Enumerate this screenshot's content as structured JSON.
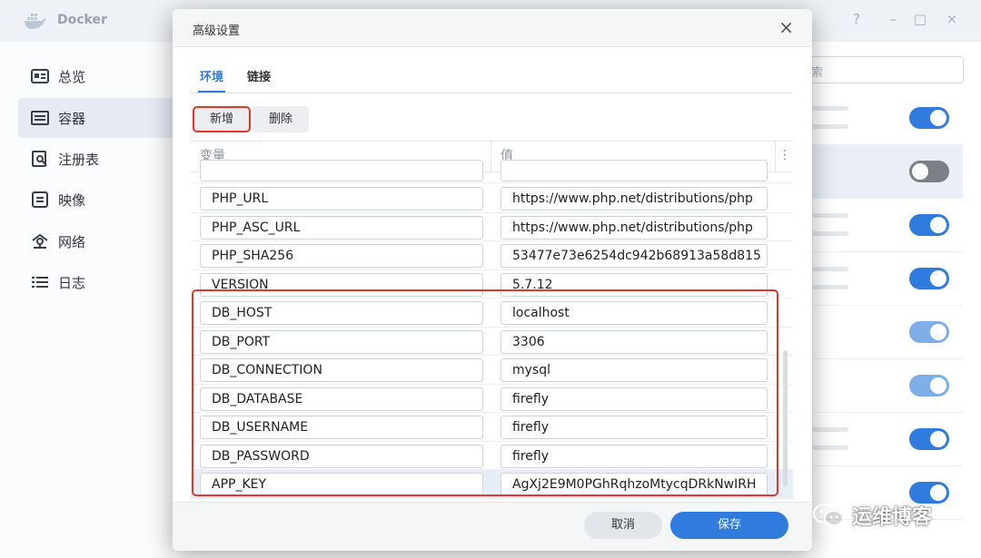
{
  "app": {
    "title": "Docker",
    "controls": [
      "?",
      "–",
      "□",
      "×"
    ]
  },
  "sidebar": {
    "items": [
      {
        "label": "总览",
        "icon": "overview-icon"
      },
      {
        "label": "容器",
        "icon": "container-list-icon",
        "active": true
      },
      {
        "label": "注册表",
        "icon": "registry-search-icon"
      },
      {
        "label": "映像",
        "icon": "image-icon"
      },
      {
        "label": "网络",
        "icon": "network-icon"
      },
      {
        "label": "日志",
        "icon": "log-list-icon"
      }
    ]
  },
  "search": {
    "placeholder": "索"
  },
  "container_list": {
    "toggles": [
      {
        "state": "on"
      },
      {
        "state": "off"
      },
      {
        "state": "on"
      },
      {
        "state": "on"
      },
      {
        "state": "on-dim"
      },
      {
        "state": "on-dim"
      },
      {
        "state": "on"
      },
      {
        "state": "on"
      }
    ]
  },
  "modal": {
    "title": "高级设置",
    "close": "×",
    "tabs": [
      {
        "label": "环境",
        "active": true
      },
      {
        "label": "链接"
      }
    ],
    "toolbar": {
      "add_label": "新增",
      "delete_label": "删除"
    },
    "table": {
      "columns": [
        "变量",
        "值"
      ],
      "more": "⋮",
      "rows": [
        {
          "key": "PHP_URL",
          "value": "https://www.php.net/distributions/php"
        },
        {
          "key": "PHP_ASC_URL",
          "value": "https://www.php.net/distributions/php"
        },
        {
          "key": "PHP_SHA256",
          "value": "53477e73e6254dc942b68913a58d815"
        },
        {
          "key": "VERSION",
          "value": "5.7.12"
        },
        {
          "key": "DB_HOST",
          "value": "localhost"
        },
        {
          "key": "DB_PORT",
          "value": "3306"
        },
        {
          "key": "DB_CONNECTION",
          "value": "mysql"
        },
        {
          "key": "DB_DATABASE",
          "value": "firefly"
        },
        {
          "key": "DB_USERNAME",
          "value": "firefly"
        },
        {
          "key": "DB_PASSWORD",
          "value": "firefly"
        },
        {
          "key": "APP_KEY",
          "value": "AgXj2E9M0PGhRqhzoMtycqDRkNwIRH",
          "highlighted": true
        }
      ]
    },
    "footer": {
      "cancel_label": "取消",
      "save_label": "保存"
    }
  },
  "watermark": {
    "text": "运维博客"
  },
  "colors": {
    "accent": "#2f7bde",
    "annotation_red": "#e0382b",
    "sidebar_active": "#e6ebf3"
  }
}
